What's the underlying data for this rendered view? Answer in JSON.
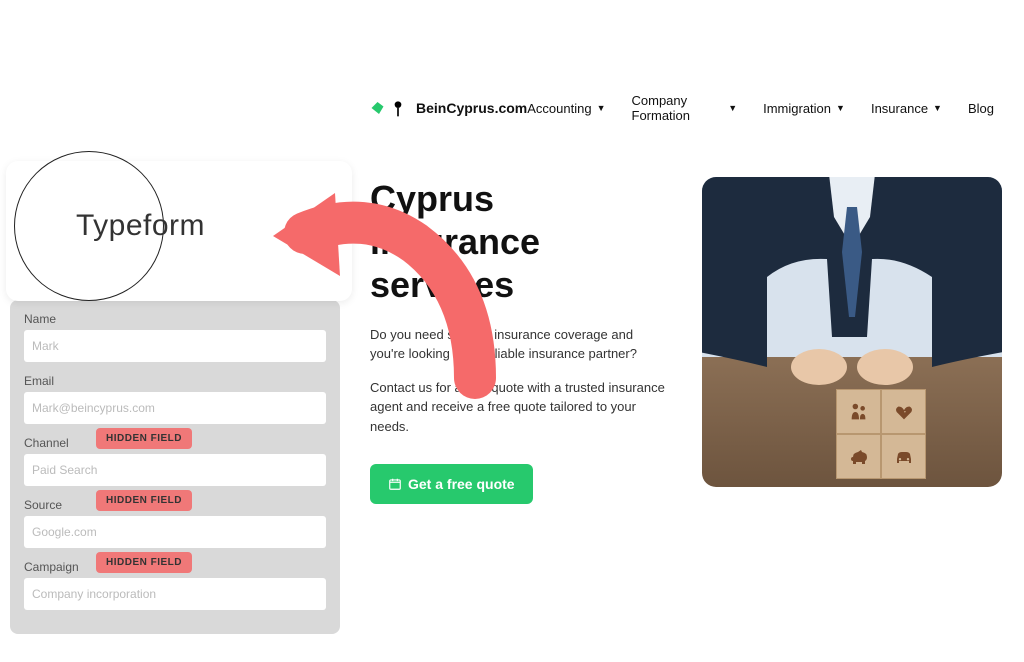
{
  "typeform": {
    "title": "Typeform",
    "fields": [
      {
        "label": "Name",
        "placeholder": "Mark",
        "hidden": false
      },
      {
        "label": "Email",
        "placeholder": "Mark@beincyprus.com",
        "hidden": false
      },
      {
        "label": "Channel",
        "placeholder": "Paid Search",
        "hidden": true
      },
      {
        "label": "Source",
        "placeholder": "Google.com",
        "hidden": true
      },
      {
        "label": "Campaign",
        "placeholder": "Company incorporation",
        "hidden": true
      }
    ],
    "hidden_badge": "HIDDEN FIELD"
  },
  "site": {
    "brand": "BeinCyprus.com",
    "nav": [
      {
        "label": "Accounting",
        "dropdown": true
      },
      {
        "label": "Company Formation",
        "dropdown": true
      },
      {
        "label": "Immigration",
        "dropdown": true
      },
      {
        "label": "Insurance",
        "dropdown": true
      },
      {
        "label": "Blog",
        "dropdown": false
      }
    ],
    "hero": {
      "title": "Cyprus insurance services",
      "para1": "Do you need specific insurance coverage and you're looking for a reliable insurance partner?",
      "para2": "Contact us for a free quote with a trusted insurance agent and receive a free quote tailored to your needs.",
      "cta": "Get a free quote"
    }
  },
  "colors": {
    "accent_green": "#27c96d",
    "badge_red": "#f07878",
    "arrow_pink": "#f56a6a"
  }
}
